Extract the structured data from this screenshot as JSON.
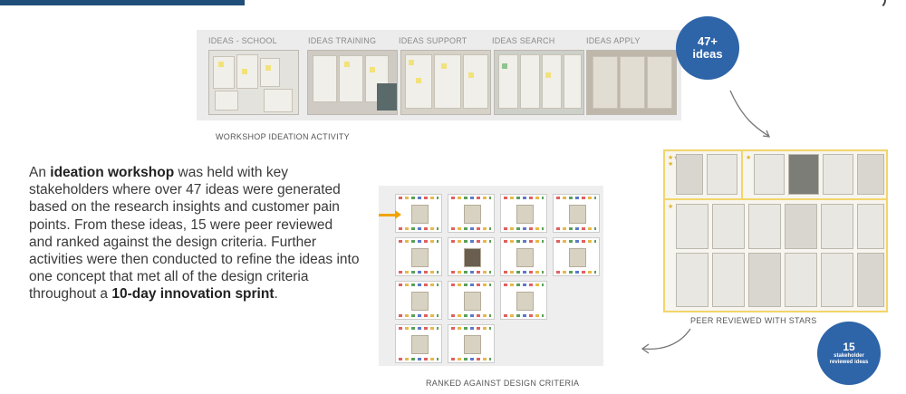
{
  "workshop": {
    "labels": [
      "IDEAS - SCHOOL",
      "IDEAS TRAINING",
      "IDEAS SUPPORT",
      "IDEAS SEARCH",
      "IDEAS APPLY"
    ],
    "caption": "WORKSHOP IDEATION ACTIVITY"
  },
  "bubble_ideas": {
    "number": "47+",
    "label": "ideas"
  },
  "bubble_reviewed": {
    "number": "15",
    "label1": "stakeholder",
    "label2": "reviewed ideas"
  },
  "peer": {
    "caption": "PEER REVIEWED WITH STARS"
  },
  "ranked": {
    "caption": "RANKED AGAINST DESIGN CRITERIA"
  },
  "paragraph": {
    "p1": "An ",
    "b1": "ideation workshop",
    "p2": " was held with key stakeholders where over 47 ideas were generated based on the research insights and customer pain points. From these ideas, 15 were peer reviewed and ranked against the design criteria. Further activities were then conducted to refine the ideas into one concept that met all of the design criteria throughout a ",
    "b2": "10-day innovation sprint",
    "p3": "."
  },
  "colors": {
    "accent_blue": "#2e64a8",
    "highlight_yellow": "#f3d56a",
    "arrow_orange": "#f0a400"
  }
}
